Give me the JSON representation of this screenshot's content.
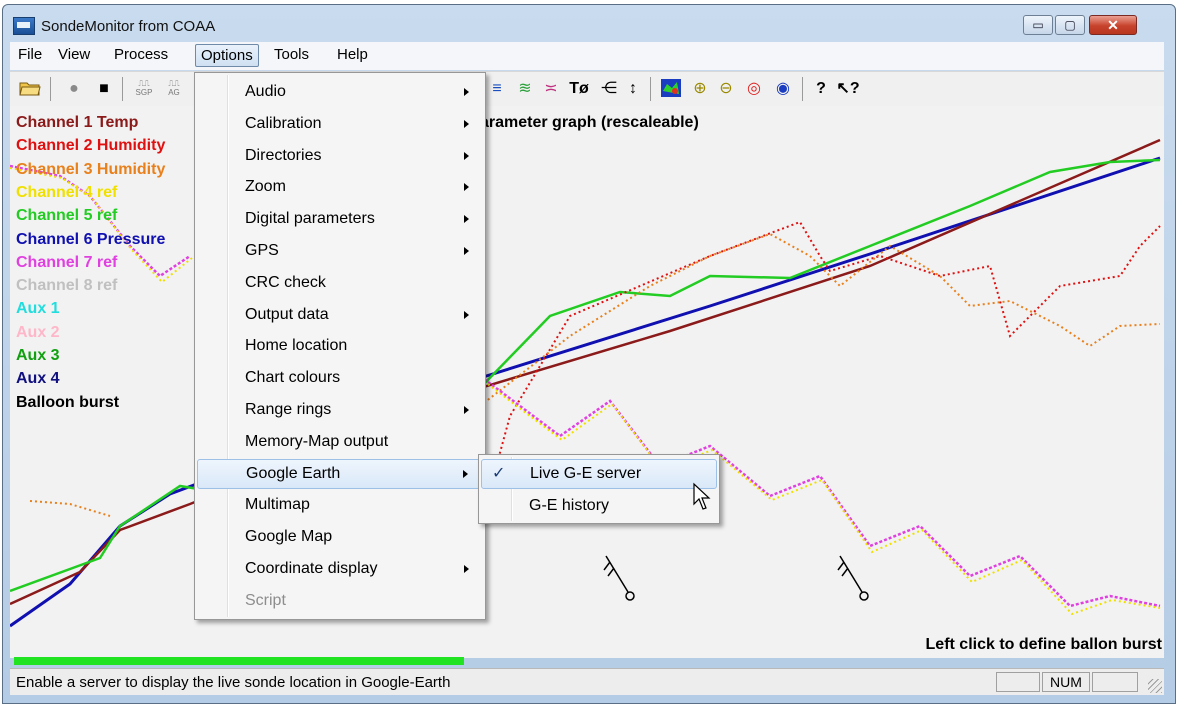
{
  "window": {
    "title": "SondeMonitor from COAA"
  },
  "titlebar_buttons": {
    "minimize": "▭",
    "maximize": "▢",
    "close": "✕"
  },
  "menubar": [
    "File",
    "View",
    "Process",
    "Options",
    "Tools",
    "Help"
  ],
  "options_menu": [
    {
      "label": "Audio",
      "submenu": true
    },
    {
      "label": "Calibration",
      "submenu": true
    },
    {
      "label": "Directories",
      "submenu": true
    },
    {
      "label": "Zoom",
      "submenu": true
    },
    {
      "label": "Digital parameters",
      "submenu": true
    },
    {
      "label": "GPS",
      "submenu": true
    },
    {
      "label": "CRC check",
      "submenu": false
    },
    {
      "label": "Output data",
      "submenu": true
    },
    {
      "label": "Home location",
      "submenu": false
    },
    {
      "label": "Chart colours",
      "submenu": false
    },
    {
      "label": "Range rings",
      "submenu": true
    },
    {
      "label": "Memory-Map output",
      "submenu": false
    },
    {
      "label": "Google Earth",
      "submenu": true,
      "highlighted": true
    },
    {
      "label": "Multimap",
      "submenu": false
    },
    {
      "label": "Google Map",
      "submenu": false
    },
    {
      "label": "Coordinate display",
      "submenu": true
    },
    {
      "label": "Script",
      "submenu": false,
      "disabled": true
    }
  ],
  "google_earth_submenu": [
    {
      "label": "Live G-E server",
      "checked": true,
      "highlighted": true
    },
    {
      "label": "G-E history",
      "checked": false
    }
  ],
  "toolbar": {
    "text_buttons": [
      "Tø"
    ],
    "icons": [
      "open-folder-icon",
      "record-icon",
      "stop-icon",
      "sgp-icon",
      "agc-icon",
      "trace-icon",
      "trace-icon",
      "trace-icon",
      "temperature-dewpoint-icon",
      "wind-icon",
      "vertical-scale-icon",
      "map-icon",
      "zoom-in-icon",
      "zoom-out-icon",
      "range-rings-icon",
      "compass-icon",
      "help-icon",
      "context-help-icon"
    ]
  },
  "chart": {
    "title_visible": "arameter graph (rescaleable)",
    "legend": [
      {
        "label": "Channel 1 Temp",
        "color": "#8b1a1a"
      },
      {
        "label": "Channel 2 Humidity",
        "color": "#e01010"
      },
      {
        "label": "Channel 3 Humidity",
        "color": "#e8801c"
      },
      {
        "label": "Channel 4 ref",
        "color": "#f0e000"
      },
      {
        "label": "Channel 5 ref",
        "color": "#22cc22"
      },
      {
        "label": "Channel 6 Pressure",
        "color": "#1010b0"
      },
      {
        "label": "Channel 7 ref",
        "color": "#e040e0"
      },
      {
        "label": "Channel 8 ref",
        "color": "#c0c0c0"
      },
      {
        "label": "Aux 1",
        "color": "#22dddd"
      },
      {
        "label": "Aux 2",
        "color": "#ffb6c8"
      },
      {
        "label": "Aux 3",
        "color": "#10a010"
      },
      {
        "label": "Aux 4",
        "color": "#101080"
      },
      {
        "label": "Balloon burst",
        "color": "#000000"
      }
    ],
    "burst_hint": "Left click to define ballon burst"
  },
  "progress": {
    "value": 0.39,
    "color": "#22e322"
  },
  "statusbar": {
    "message": "Enable a server to display the live sonde location in Google-Earth",
    "panels": [
      "",
      "NUM",
      ""
    ]
  }
}
